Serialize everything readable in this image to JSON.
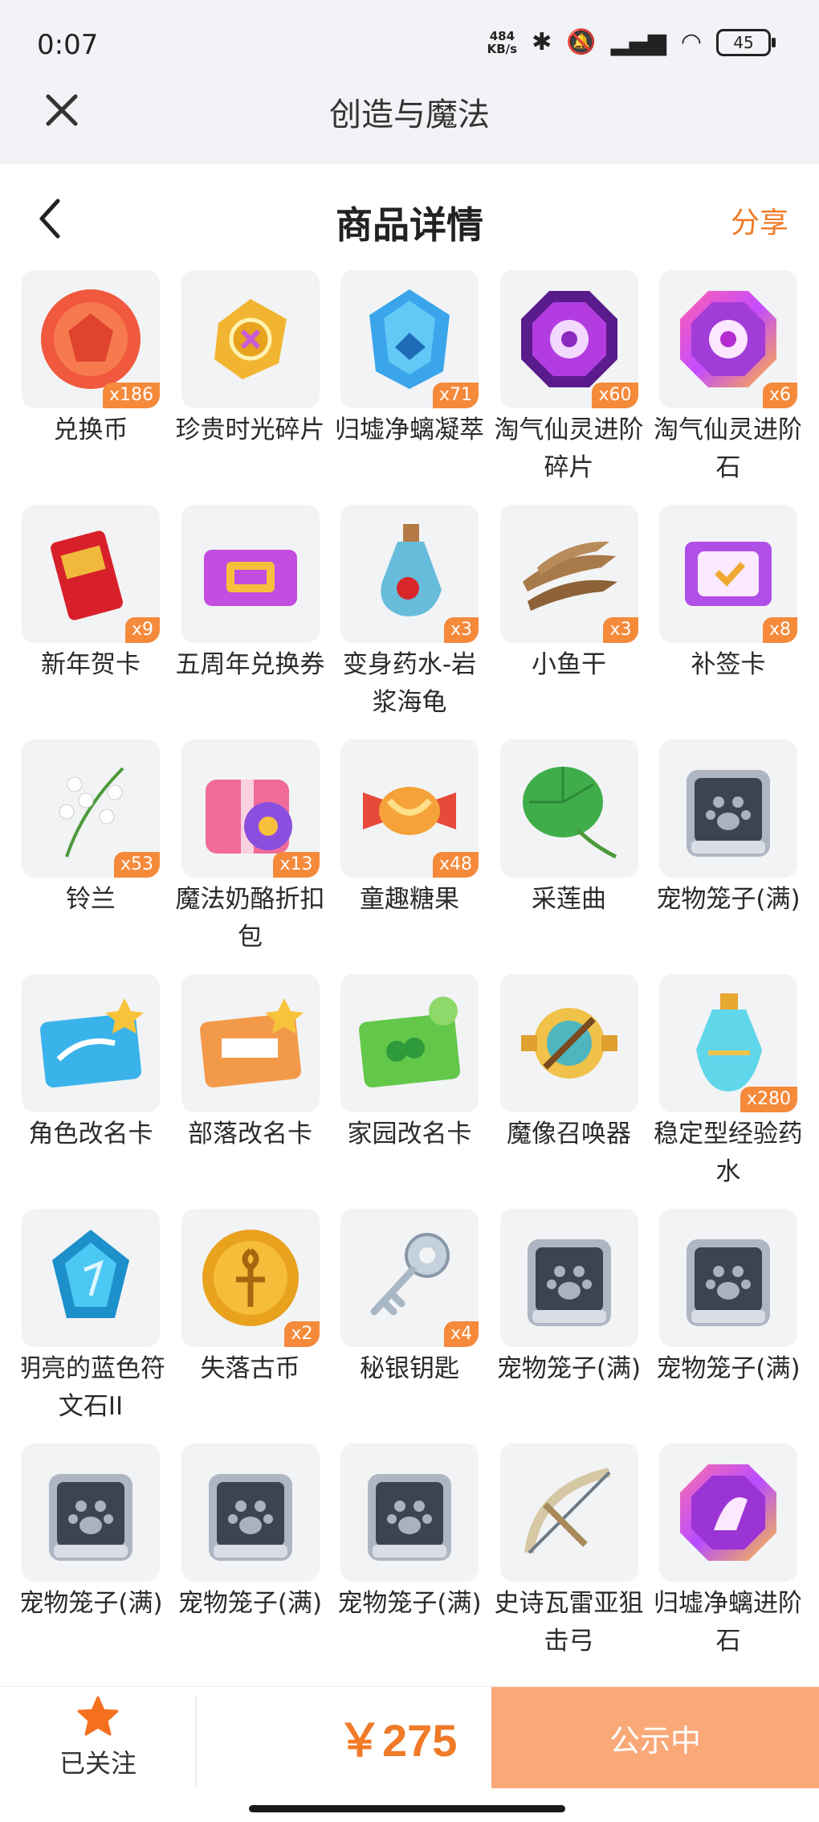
{
  "status": {
    "time": "0:07",
    "netspeed_value": "484",
    "netspeed_unit": "KB/s",
    "battery": "45"
  },
  "app": {
    "title": "创造与魔法"
  },
  "nav": {
    "title": "商品详情",
    "share": "分享"
  },
  "items": [
    {
      "name": "兑换币",
      "qty": "x186",
      "icon": "red-coin"
    },
    {
      "name": "珍贵时光碎片",
      "qty": "",
      "icon": "gold-fragment"
    },
    {
      "name": "归墟净螭凝萃",
      "qty": "x71",
      "icon": "blue-crystal"
    },
    {
      "name": "淘气仙灵进阶碎片",
      "qty": "x60",
      "icon": "purple-octagon"
    },
    {
      "name": "淘气仙灵进阶石",
      "qty": "x6",
      "icon": "rainbow-octagon"
    },
    {
      "name": "新年贺卡",
      "qty": "x9",
      "icon": "red-card"
    },
    {
      "name": "五周年兑换券",
      "qty": "",
      "icon": "anniversary-ticket"
    },
    {
      "name": "变身药水-岩浆海龟",
      "qty": "x3",
      "icon": "potion-bottle"
    },
    {
      "name": "小鱼干",
      "qty": "x3",
      "icon": "dried-fish"
    },
    {
      "name": "补签卡",
      "qty": "x8",
      "icon": "purple-card"
    },
    {
      "name": "铃兰",
      "qty": "x53",
      "icon": "lily-flower"
    },
    {
      "name": "魔法奶酪折扣包",
      "qty": "x13",
      "icon": "gift-pack"
    },
    {
      "name": "童趣糖果",
      "qty": "x48",
      "icon": "candy"
    },
    {
      "name": "采莲曲",
      "qty": "",
      "icon": "lotus-leaf"
    },
    {
      "name": "宠物笼子(满)",
      "qty": "",
      "icon": "pet-cage"
    },
    {
      "name": "角色改名卡",
      "qty": "",
      "icon": "blue-rename-card"
    },
    {
      "name": "部落改名卡",
      "qty": "",
      "icon": "orange-rename-card"
    },
    {
      "name": "家园改名卡",
      "qty": "",
      "icon": "green-rename-card"
    },
    {
      "name": "魔像召唤器",
      "qty": "",
      "icon": "golem-summoner"
    },
    {
      "name": "稳定型经验药水",
      "qty": "x280",
      "icon": "exp-potion"
    },
    {
      "name": "明亮的蓝色符文石II",
      "qty": "",
      "icon": "blue-rune"
    },
    {
      "name": "失落古币",
      "qty": "x2",
      "icon": "gold-coin"
    },
    {
      "name": "秘银钥匙",
      "qty": "x4",
      "icon": "silver-key"
    },
    {
      "name": "宠物笼子(满)",
      "qty": "",
      "icon": "pet-cage"
    },
    {
      "name": "宠物笼子(满)",
      "qty": "",
      "icon": "pet-cage"
    },
    {
      "name": "宠物笼子(满)",
      "qty": "",
      "icon": "pet-cage"
    },
    {
      "name": "宠物笼子(满)",
      "qty": "",
      "icon": "pet-cage"
    },
    {
      "name": "宠物笼子(满)",
      "qty": "",
      "icon": "pet-cage"
    },
    {
      "name": "史诗瓦雷亚狙击弓",
      "qty": "",
      "icon": "crossbow"
    },
    {
      "name": "归墟净螭进阶石",
      "qty": "",
      "icon": "rainbow-octagon-2"
    }
  ],
  "bottom": {
    "follow_label": "已关注",
    "price": "￥275",
    "action": "公示中"
  },
  "colors": {
    "accent": "#f07a28",
    "button": "#f9a978",
    "qty_badge": "#f58a3b"
  }
}
